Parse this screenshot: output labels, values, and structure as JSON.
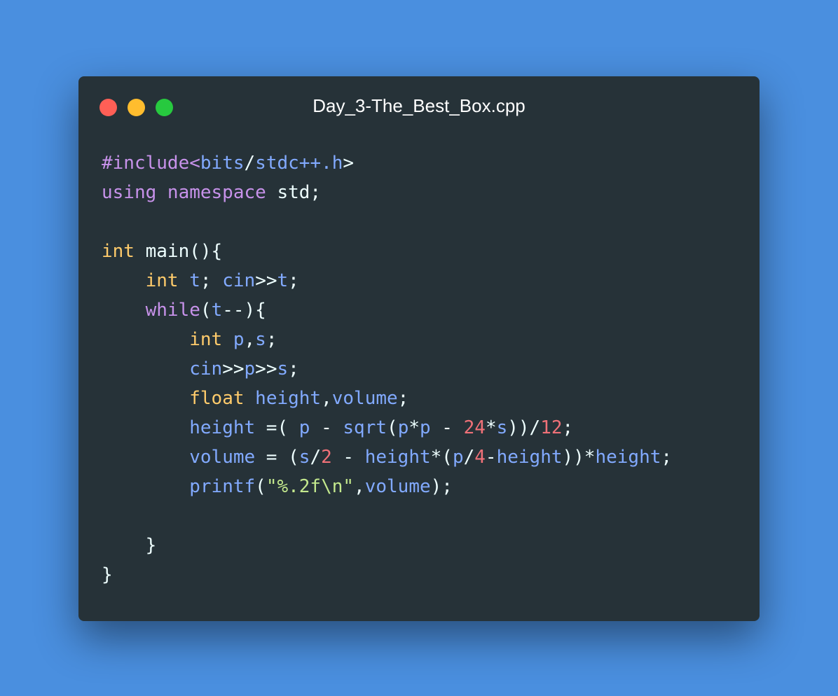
{
  "window": {
    "title": "Day_3-The_Best_Box.cpp",
    "controls": [
      {
        "name": "close-button",
        "color": "#ff5f56"
      },
      {
        "name": "minimize-button",
        "color": "#ffbd2e"
      },
      {
        "name": "zoom-button",
        "color": "#27c93f"
      }
    ]
  },
  "theme": {
    "background": "#4a8fdf",
    "editor_background": "#263238",
    "default_text": "#eeffff",
    "keyword_type": "#ffcb6b",
    "keyword_control": "#c792ea",
    "identifier": "#82aaff",
    "number": "#f07178",
    "string": "#c3e88d"
  },
  "code": [
    [
      [
        "#include<",
        "p"
      ],
      [
        "bits",
        "b"
      ],
      [
        "/",
        "t"
      ],
      [
        "stdc++.h",
        "b"
      ],
      [
        ">",
        "t"
      ]
    ],
    [
      [
        "using namespace",
        "k"
      ],
      [
        " std;",
        "t"
      ]
    ],
    [],
    [
      [
        "int",
        "y"
      ],
      [
        " main(){",
        "t"
      ]
    ],
    [
      [
        "    ",
        "t"
      ],
      [
        "int",
        "y"
      ],
      [
        " t",
        "b"
      ],
      [
        "; ",
        "t"
      ],
      [
        "cin",
        "b"
      ],
      [
        ">>",
        "t"
      ],
      [
        "t",
        "b"
      ],
      [
        ";",
        "t"
      ]
    ],
    [
      [
        "    ",
        "t"
      ],
      [
        "while",
        "k"
      ],
      [
        "(",
        "t"
      ],
      [
        "t",
        "b"
      ],
      [
        "--){",
        "t"
      ]
    ],
    [
      [
        "        ",
        "t"
      ],
      [
        "int",
        "y"
      ],
      [
        " p",
        "b"
      ],
      [
        ",",
        "t"
      ],
      [
        "s",
        "b"
      ],
      [
        ";",
        "t"
      ]
    ],
    [
      [
        "        ",
        "t"
      ],
      [
        "cin",
        "b"
      ],
      [
        ">>",
        "t"
      ],
      [
        "p",
        "b"
      ],
      [
        ">>",
        "t"
      ],
      [
        "s",
        "b"
      ],
      [
        ";",
        "t"
      ]
    ],
    [
      [
        "        ",
        "t"
      ],
      [
        "float",
        "y"
      ],
      [
        " height",
        "b"
      ],
      [
        ",",
        "t"
      ],
      [
        "volume",
        "b"
      ],
      [
        ";",
        "t"
      ]
    ],
    [
      [
        "        ",
        "t"
      ],
      [
        "height",
        "b"
      ],
      [
        " =( ",
        "t"
      ],
      [
        "p",
        "b"
      ],
      [
        " - ",
        "t"
      ],
      [
        "sqrt",
        "b"
      ],
      [
        "(",
        "t"
      ],
      [
        "p",
        "b"
      ],
      [
        "*",
        "t"
      ],
      [
        "p",
        "b"
      ],
      [
        " - ",
        "t"
      ],
      [
        "24",
        "n"
      ],
      [
        "*",
        "t"
      ],
      [
        "s",
        "b"
      ],
      [
        "))/",
        "t"
      ],
      [
        "12",
        "n"
      ],
      [
        ";",
        "t"
      ]
    ],
    [
      [
        "        ",
        "t"
      ],
      [
        "volume",
        "b"
      ],
      [
        " = (",
        "t"
      ],
      [
        "s",
        "b"
      ],
      [
        "/",
        "t"
      ],
      [
        "2",
        "n"
      ],
      [
        " - ",
        "t"
      ],
      [
        "height",
        "b"
      ],
      [
        "*(",
        "t"
      ],
      [
        "p",
        "b"
      ],
      [
        "/",
        "t"
      ],
      [
        "4",
        "n"
      ],
      [
        "-",
        "t"
      ],
      [
        "height",
        "b"
      ],
      [
        "))*",
        "t"
      ],
      [
        "height",
        "b"
      ],
      [
        ";",
        "t"
      ]
    ],
    [
      [
        "        ",
        "t"
      ],
      [
        "printf",
        "b"
      ],
      [
        "(",
        "t"
      ],
      [
        "\"%.2f\\n\"",
        "s"
      ],
      [
        ",",
        "t"
      ],
      [
        "volume",
        "b"
      ],
      [
        ");",
        "t"
      ]
    ],
    [],
    [
      [
        "    }",
        "t"
      ]
    ],
    [
      [
        "}",
        "t"
      ]
    ]
  ]
}
